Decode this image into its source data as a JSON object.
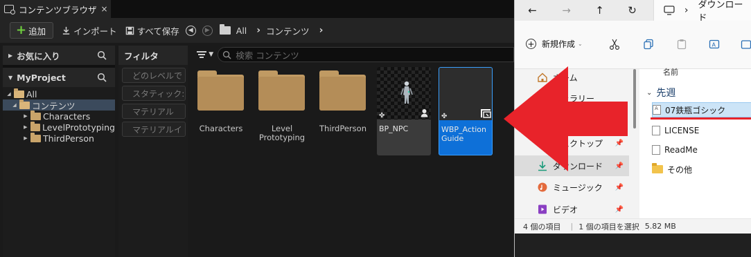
{
  "ue": {
    "tab_title": "コンテンツブラウザ",
    "tab_close": "×",
    "toolbar": {
      "add_label": "追加",
      "import_label": "インポート",
      "save_all_label": "すべて保存",
      "breadcrumb": [
        "All",
        "コンテンツ"
      ]
    },
    "favorites": {
      "title": "お気に入り"
    },
    "project": {
      "title": "MyProject",
      "tree": [
        {
          "label": "All",
          "depth": 0,
          "open": true,
          "selected": false
        },
        {
          "label": "コンテンツ",
          "depth": 1,
          "open": true,
          "selected": true
        },
        {
          "label": "Characters",
          "depth": 2,
          "open": false,
          "selected": false
        },
        {
          "label": "LevelPrototyping",
          "depth": 2,
          "open": false,
          "selected": false
        },
        {
          "label": "ThirdPerson",
          "depth": 2,
          "open": false,
          "selected": false
        }
      ]
    },
    "filters": {
      "title": "フィルタ",
      "items": [
        "どのレベルで",
        "スタティック:",
        "マテリアル",
        "マテリアルイ"
      ]
    },
    "search": {
      "placeholder": "検索 コンテンツ"
    },
    "assets": [
      {
        "type": "folder",
        "label": "Characters"
      },
      {
        "type": "folder",
        "label": "Level Prototyping"
      },
      {
        "type": "folder",
        "label": "ThirdPerson"
      },
      {
        "type": "blueprint",
        "label": "BP_NPC"
      },
      {
        "type": "widget",
        "label": "WBP_Action Guide",
        "selected": true
      }
    ]
  },
  "explorer": {
    "address": "ダウンロード",
    "new_label": "新規作成",
    "nav_items": [
      {
        "label": "ホーム",
        "icon": "home-icon"
      },
      {
        "label": "ギャラリー",
        "icon": "gallery-icon"
      },
      {
        "label": "デスクトップ",
        "icon": "desktop-icon"
      },
      {
        "label": "ダウンロード",
        "icon": "download-icon",
        "selected": true
      },
      {
        "label": "ミュージック",
        "icon": "music-icon"
      },
      {
        "label": "ビデオ",
        "icon": "video-icon"
      }
    ],
    "column_name": "名前",
    "group": "先週",
    "files": [
      {
        "name": "07鉄瓶ゴシック",
        "type": "font",
        "selected": true
      },
      {
        "name": "LICENSE",
        "type": "file"
      },
      {
        "name": "ReadMe",
        "type": "file"
      },
      {
        "name": "その他",
        "type": "folder"
      }
    ],
    "status": {
      "count": "4 個の項目",
      "selection": "1 個の項目を選択",
      "size": "5.82 MB"
    }
  },
  "annotation": {
    "arrow_color": "#e8232a"
  }
}
